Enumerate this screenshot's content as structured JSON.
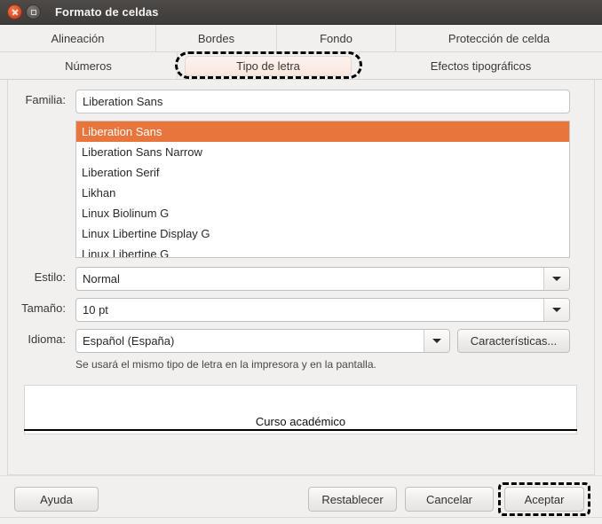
{
  "window": {
    "title": "Formato de celdas",
    "close_icon": "close-icon",
    "restore_icon": "restore-icon"
  },
  "tabs": {
    "row1": [
      {
        "label": "Alineación",
        "active": false
      },
      {
        "label": "Bordes",
        "active": false
      },
      {
        "label": "Fondo",
        "active": false
      },
      {
        "label": "Protección de celda",
        "active": false
      }
    ],
    "row2": [
      {
        "label": "Números",
        "active": false
      },
      {
        "label": "Tipo de letra",
        "active": true
      },
      {
        "label": "Efectos tipográficos",
        "active": false
      }
    ]
  },
  "form": {
    "familia_label": "Familia:",
    "familia_value": "Liberation Sans",
    "estilo_label": "Estilo:",
    "estilo_value": "Normal",
    "tamano_label": "Tamaño:",
    "tamano_value": "10 pt",
    "idioma_label": "Idioma:",
    "idioma_value": "Español (España)",
    "caracteristicas_label": "Características...",
    "hint": "Se usará el mismo tipo de letra en la impresora y en la pantalla.",
    "dropdown_icon": "chevron-down-icon"
  },
  "font_list": {
    "selected": "Liberation Sans",
    "items": [
      "Liberation Sans",
      "Liberation Sans Narrow",
      "Liberation Serif",
      "Likhan",
      "Linux Biolinum G",
      "Linux Libertine Display G",
      "Linux Libertine G"
    ]
  },
  "preview": {
    "text": "Curso académico"
  },
  "footer": {
    "help_label": "Ayuda",
    "reset_label": "Restablecer",
    "cancel_label": "Cancelar",
    "accept_label": "Aceptar"
  },
  "colors": {
    "selection_orange": "#e8763c",
    "titlebar": "#454240",
    "panel_bg": "#f2f0ee",
    "active_tab_bg": "#f9e7de",
    "annotation": "#000000"
  }
}
